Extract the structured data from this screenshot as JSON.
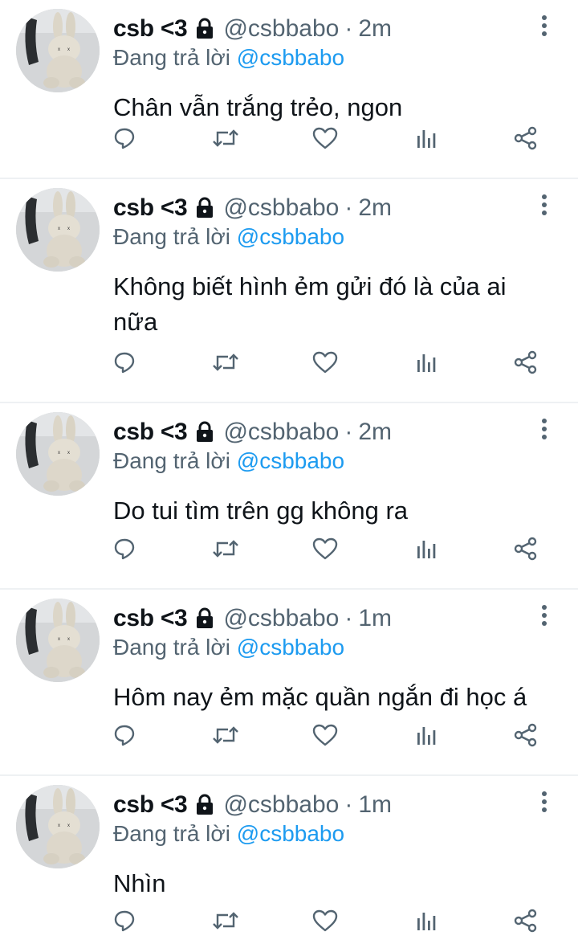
{
  "labels": {
    "reply_prefix": "Đang trả lời",
    "dot": "·"
  },
  "colors": {
    "name": "#0f1419",
    "secondary": "#536471",
    "link": "#1d9bf0",
    "divider": "#eef1f3"
  },
  "icons": {
    "lock": "lock-icon",
    "more": "more-vertical-icon",
    "reply": "reply-icon",
    "retweet": "retweet-icon",
    "like": "heart-icon",
    "views": "analytics-icon",
    "share": "share-icon"
  },
  "tweets": [
    {
      "name": "csb <3",
      "handle": "@csbbabo",
      "time": "2m",
      "reply_to": "@csbbabo",
      "text": "Chân vẫn trắng trẻo, ngon"
    },
    {
      "name": "csb <3",
      "handle": "@csbbabo",
      "time": "2m",
      "reply_to": "@csbbabo",
      "text": "Không biết hình ẻm gửi đó là của ai nữa"
    },
    {
      "name": "csb <3",
      "handle": "@csbbabo",
      "time": "2m",
      "reply_to": "@csbbabo",
      "text": "Do tui tìm trên gg không ra"
    },
    {
      "name": "csb <3",
      "handle": "@csbbabo",
      "time": "1m",
      "reply_to": "@csbbabo",
      "text": "Hôm nay ẻm mặc quần ngắn đi học á"
    },
    {
      "name": "csb <3",
      "handle": "@csbbabo",
      "time": "1m",
      "reply_to": "@csbbabo",
      "text": "Nhìn"
    }
  ]
}
